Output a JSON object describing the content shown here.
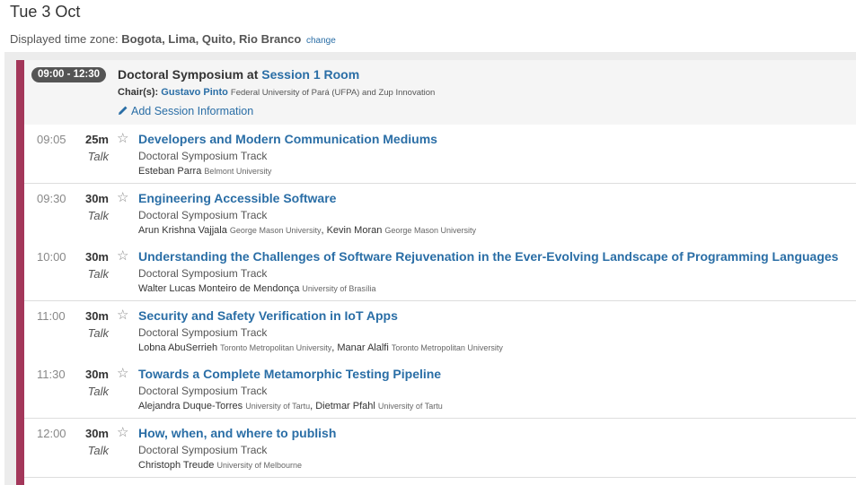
{
  "header": {
    "date": "Tue 3 Oct",
    "tz_label": "Displayed time zone:",
    "tz_value": "Bogota, Lima, Quito, Rio Branco",
    "tz_change": "change"
  },
  "session": {
    "time": "09:00 - 12:30",
    "title": "Doctoral Symposium at ",
    "room": "Session 1 Room",
    "chair_label": "Chair(s):",
    "chair_name": "Gustavo Pinto",
    "chair_affiliation": "Federal University of Pará (UFPA) and Zup Innovation",
    "add_info": "Add Session Information"
  },
  "talks": [
    {
      "time": "09:05",
      "duration": "25m",
      "kind": "Talk",
      "title": "Developers and Modern Communication Mediums",
      "track": "Doctoral Symposium Track",
      "authors": [
        {
          "name": "Esteban Parra",
          "aff": "Belmont University"
        }
      ]
    },
    {
      "time": "09:30",
      "duration": "30m",
      "kind": "Talk",
      "title": "Engineering Accessible Software",
      "track": "Doctoral Symposium Track",
      "authors": [
        {
          "name": "Arun Krishna Vajjala",
          "aff": "George Mason University"
        },
        {
          "name": "Kevin Moran",
          "aff": "George Mason University"
        }
      ]
    },
    {
      "time": "10:00",
      "duration": "30m",
      "kind": "Talk",
      "title": "Understanding the Challenges of Software Rejuvenation in the Ever-Evolving Landscape of Programming Languages",
      "track": "Doctoral Symposium Track",
      "authors": [
        {
          "name": "Walter Lucas Monteiro de Mendonça",
          "aff": "University of Brasília"
        }
      ]
    },
    {
      "time": "11:00",
      "duration": "30m",
      "kind": "Talk",
      "title": "Security and Safety Verification in IoT Apps",
      "track": "Doctoral Symposium Track",
      "authors": [
        {
          "name": "Lobna AbuSerrieh",
          "aff": "Toronto Metropolitan University"
        },
        {
          "name": "Manar Alalfi",
          "aff": "Toronto Metropolitan University"
        }
      ]
    },
    {
      "time": "11:30",
      "duration": "30m",
      "kind": "Talk",
      "title": "Towards a Complete Metamorphic Testing Pipeline",
      "track": "Doctoral Symposium Track",
      "authors": [
        {
          "name": "Alejandra Duque-Torres",
          "aff": "University of Tartu"
        },
        {
          "name": "Dietmar Pfahl",
          "aff": "University of Tartu"
        }
      ]
    },
    {
      "time": "12:00",
      "duration": "30m",
      "kind": "Talk",
      "title": "How, when, and where to publish",
      "track": "Doctoral Symposium Track",
      "authors": [
        {
          "name": "Christoph Treude",
          "aff": "University of Melbourne"
        }
      ]
    }
  ],
  "colors": {
    "accent": "#a3375a",
    "link": "#2a6ea6",
    "badge": "#555555"
  },
  "icons": {
    "star": "star-outline-icon",
    "edit": "pencil-icon"
  }
}
